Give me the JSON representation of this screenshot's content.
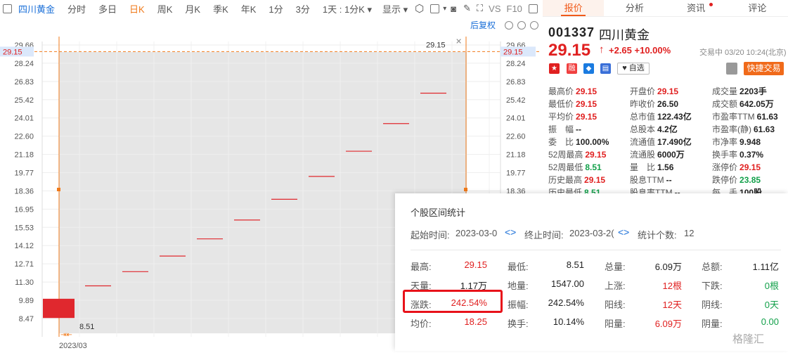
{
  "toolbar": {
    "stock_name": "四川黄金",
    "periods": [
      "分时",
      "多日",
      "日K",
      "周K",
      "月K",
      "季K",
      "年K",
      "1分",
      "3分"
    ],
    "active_period": "日K",
    "interval_select": "1天 : 1分K",
    "display_select": "显示",
    "vs_label": "VS",
    "f10_label": "F10"
  },
  "chart": {
    "fuquan_label": "后复权",
    "y_ticks": [
      "29.66",
      "28.24",
      "26.83",
      "25.42",
      "24.01",
      "22.60",
      "21.18",
      "19.77",
      "18.36",
      "16.95",
      "15.53",
      "14.12",
      "12.71",
      "11.30",
      "9.89",
      "8.47"
    ],
    "crosshair_value": "29.15",
    "tooltip_value": "29.15",
    "low_label": "8.51",
    "x_label": "2023/03",
    "candles": [
      {
        "open": 8.51,
        "close": 10.0,
        "high": 10.0,
        "low": 8.51
      },
      {
        "open": 11.0,
        "close": 11.0,
        "high": 11.0,
        "low": 11.0
      },
      {
        "open": 12.1,
        "close": 12.1,
        "high": 12.1,
        "low": 12.1
      },
      {
        "open": 13.31,
        "close": 13.31,
        "high": 13.31,
        "low": 13.31
      },
      {
        "open": 14.64,
        "close": 14.64,
        "high": 14.64,
        "low": 14.64
      },
      {
        "open": 16.1,
        "close": 16.1,
        "high": 16.1,
        "low": 16.1
      },
      {
        "open": 17.71,
        "close": 17.71,
        "high": 17.71,
        "low": 17.71
      },
      {
        "open": 19.48,
        "close": 19.48,
        "high": 19.48,
        "low": 19.48
      },
      {
        "open": 21.43,
        "close": 21.43,
        "high": 21.43,
        "low": 21.43
      },
      {
        "open": 23.57,
        "close": 23.57,
        "high": 23.57,
        "low": 23.57
      },
      {
        "open": 25.93,
        "close": 25.93,
        "high": 25.93,
        "low": 25.93
      }
    ],
    "colors": {
      "up": "#e0282e",
      "crosshair": "#f07a1a",
      "selection": "#e6e6e6"
    }
  },
  "panel": {
    "tabs": [
      "报价",
      "分析",
      "资讯",
      "评论"
    ],
    "code": "001337",
    "name": "四川黄金",
    "price": "29.15",
    "arrow": "↑",
    "change": "+2.65 +10.00%",
    "status": "交易中 03/20 10:24(北京)",
    "zixuan": "自选",
    "quick_trade": "快捷交易",
    "quotes": [
      [
        {
          "l": "最高价",
          "v": "29.15",
          "c": "red"
        },
        {
          "l": "开盘价",
          "v": "29.15",
          "c": "red"
        },
        {
          "l": "成交量",
          "v": "2203手",
          "c": "dark"
        }
      ],
      [
        {
          "l": "最低价",
          "v": "29.15",
          "c": "red"
        },
        {
          "l": "昨收价",
          "v": "26.50",
          "c": "dark"
        },
        {
          "l": "成交额",
          "v": "642.05万",
          "c": "dark"
        }
      ],
      [
        {
          "l": "平均价",
          "v": "29.15",
          "c": "red"
        },
        {
          "l": "总市值",
          "v": "122.43亿",
          "c": "dark"
        },
        {
          "l": "市盈率TTM",
          "v": "61.63",
          "c": "dark"
        }
      ],
      [
        {
          "l": "振　幅",
          "v": "--",
          "c": "dark"
        },
        {
          "l": "总股本",
          "v": "4.2亿",
          "c": "dark"
        },
        {
          "l": "市盈率(静)",
          "v": "61.63",
          "c": "dark"
        }
      ],
      [
        {
          "l": "委　比",
          "v": "100.00%",
          "c": "dark"
        },
        {
          "l": "流通值",
          "v": "17.490亿",
          "c": "dark"
        },
        {
          "l": "市净率",
          "v": "9.948",
          "c": "dark"
        }
      ],
      [
        {
          "l": "52周最高",
          "v": "29.15",
          "c": "red"
        },
        {
          "l": "流通股",
          "v": "6000万",
          "c": "dark"
        },
        {
          "l": "换手率",
          "v": "0.37%",
          "c": "dark"
        }
      ],
      [
        {
          "l": "52周最低",
          "v": "8.51",
          "c": "green"
        },
        {
          "l": "量　比",
          "v": "1.56",
          "c": "dark"
        },
        {
          "l": "涨停价",
          "v": "29.15",
          "c": "red"
        }
      ],
      [
        {
          "l": "历史最高",
          "v": "29.15",
          "c": "red"
        },
        {
          "l": "股息TTM",
          "v": "--",
          "c": "dark"
        },
        {
          "l": "跌停价",
          "v": "23.85",
          "c": "green"
        }
      ],
      [
        {
          "l": "历史最低",
          "v": "8.51",
          "c": "green"
        },
        {
          "l": "股息率TTM",
          "v": "--",
          "c": "dark"
        },
        {
          "l": "每　手",
          "v": "100股",
          "c": "dark"
        }
      ]
    ]
  },
  "stats": {
    "title": "个股区间统计",
    "start_label": "起始时间:",
    "start_value": "2023-03-0",
    "end_label": "终止时间:",
    "end_value": "2023-03-2(",
    "count_label": "统计个数:",
    "count_value": "12",
    "rows": [
      [
        {
          "l": "最高:",
          "v": "29.15",
          "c": "red"
        },
        {
          "l": "最低:",
          "v": "8.51",
          "c": "dark"
        },
        {
          "l": "总量:",
          "v": "6.09万",
          "c": "dark"
        },
        {
          "l": "总额:",
          "v": "1.11亿",
          "c": "dark"
        }
      ],
      [
        {
          "l": "天量:",
          "v": "1.17万",
          "c": "dark"
        },
        {
          "l": "地量:",
          "v": "1547.00",
          "c": "dark"
        },
        {
          "l": "上涨:",
          "v": "12根",
          "c": "red"
        },
        {
          "l": "下跌:",
          "v": "0根",
          "c": "green"
        }
      ],
      [
        {
          "l": "涨跌:",
          "v": "242.54%",
          "c": "red"
        },
        {
          "l": "振幅:",
          "v": "242.54%",
          "c": "dark"
        },
        {
          "l": "阳线:",
          "v": "12天",
          "c": "red"
        },
        {
          "l": "阴线:",
          "v": "0天",
          "c": "green"
        }
      ],
      [
        {
          "l": "均价:",
          "v": "18.25",
          "c": "red"
        },
        {
          "l": "换手:",
          "v": "10.14%",
          "c": "dark"
        },
        {
          "l": "阳量:",
          "v": "6.09万",
          "c": "red"
        },
        {
          "l": "阴量:",
          "v": "0.00",
          "c": "green"
        }
      ]
    ],
    "watermark": "格隆汇"
  }
}
